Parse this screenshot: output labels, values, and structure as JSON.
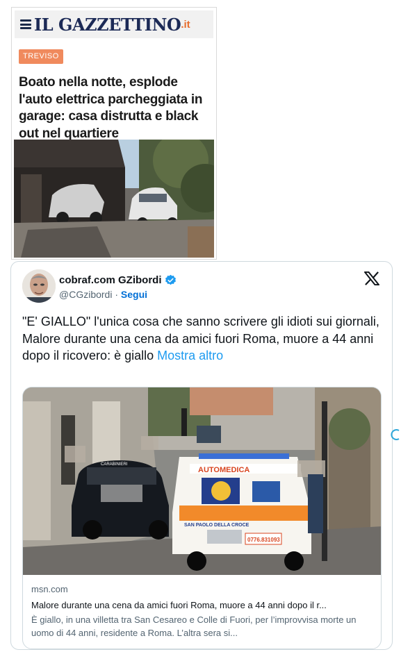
{
  "gazzettino": {
    "logo": "IL GAZZETTINO",
    "logo_tld": ".it",
    "category_tag": "TREVISO",
    "headline": "Boato nella notte, esplode l'auto elettrica parcheggiata in garage: casa distrutta e black out nel quartiere"
  },
  "tweet": {
    "author_name": "cobraf.com GZibordi",
    "handle": "@CGzibordi",
    "separator": "·",
    "follow_label": "Segui",
    "text_line1": "\"E' GIALLO\" l'unica cosa che sanno scrivere gli idioti sui giornali,",
    "text_line2": "Malore durante una cena da amici fuori Roma, muore a 44 anni dopo il ricovero: è giallo",
    "show_more_label": "Mostra altro",
    "card": {
      "domain": "msn.com",
      "title": "Malore durante una cena da amici fuori Roma, muore a 44 anni dopo il r...",
      "description": "È giallo, in una villetta tra San Cesareo e Colle di Fuori, per l’improvvisa morte un uomo di 44 anni, residente a Roma. L’altra sera si...",
      "ambulance_label": "AUTOMEDICA",
      "ambulance_sub": "SAN PAOLO DELLA CROCE",
      "ambulance_phone": "0776.831093",
      "police_label": "CARABINIERI"
    }
  },
  "icons": {
    "verified": "verified-badge-icon",
    "x_logo": "x-logo-icon",
    "menu": "hamburger-menu-icon"
  },
  "colors": {
    "link": "#1d9bf0",
    "follow": "#006fd6",
    "tag": "#f08a5d",
    "logo": "#1c2a56"
  }
}
